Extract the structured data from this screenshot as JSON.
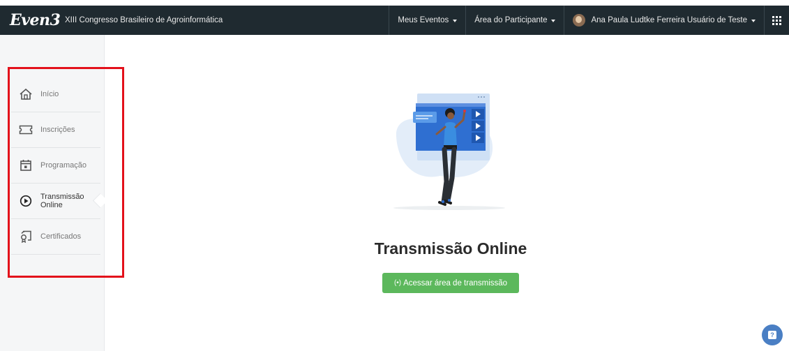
{
  "header": {
    "logo": "Even3",
    "event_title": "XIII Congresso Brasileiro de Agroinformática",
    "nav": {
      "my_events": "Meus Eventos",
      "participant_area": "Área do Participante",
      "user_name": "Ana Paula Ludtke Ferreira Usuário de Teste"
    }
  },
  "sidebar": {
    "items": [
      {
        "label": "Início",
        "icon": "home-icon"
      },
      {
        "label": "Inscrições",
        "icon": "ticket-icon"
      },
      {
        "label": "Programação",
        "icon": "calendar-icon"
      },
      {
        "label": "Transmissão Online",
        "icon": "play-circle-icon",
        "active": true
      },
      {
        "label": "Certificados",
        "icon": "certificate-icon"
      }
    ]
  },
  "main": {
    "heading": "Transmissão Online",
    "button_label": "Acessar área de transmissão",
    "button_icon": "(•)"
  },
  "colors": {
    "topbar": "#1f2a30",
    "sidebar_bg": "#f5f6f7",
    "button_green": "#5cb85c",
    "highlight_red": "#e3111b",
    "help_blue": "#4a7fc4"
  }
}
